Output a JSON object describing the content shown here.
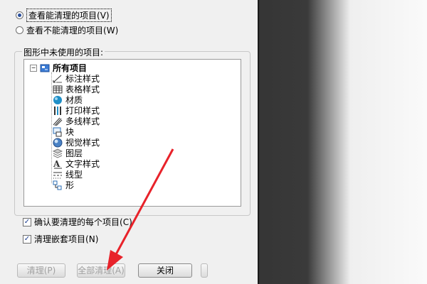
{
  "radios": [
    {
      "label": "查看能清理的项目",
      "key": "V",
      "selected": true
    },
    {
      "label": "查看不能清理的项目",
      "key": "W",
      "selected": false
    }
  ],
  "tree_group": {
    "legend": "图形中未使用的项目:",
    "root": "所有项目",
    "items": [
      "标注样式",
      "表格样式",
      "材质",
      "打印样式",
      "多线样式",
      "块",
      "视觉样式",
      "图层",
      "文字样式",
      "线型",
      "形"
    ]
  },
  "checkboxes": [
    {
      "label": "确认要清理的每个项目",
      "key": "C",
      "checked": true
    },
    {
      "label": "清理嵌套项目",
      "key": "N",
      "checked": true
    }
  ],
  "buttons": {
    "purge": "清理(P)",
    "purge_all": "全部清理(A)",
    "close": "关闭"
  },
  "colors": {
    "arrow": "#e8222a",
    "accent": "#2a4f9c"
  }
}
